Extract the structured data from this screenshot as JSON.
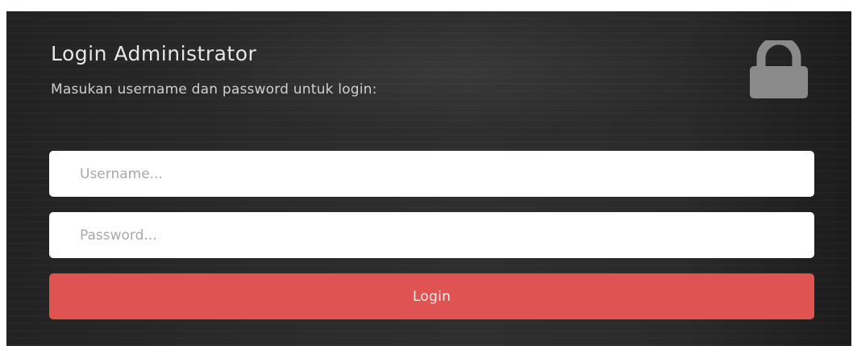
{
  "login_form": {
    "title": "Login Administrator",
    "subtitle": "Masukan username dan password untuk login:",
    "lock_icon": "lock-icon",
    "username": {
      "value": "",
      "placeholder": "Username..."
    },
    "password": {
      "value": "",
      "placeholder": "Password..."
    },
    "login_label": "Login"
  },
  "colors": {
    "panel_background": "#2a2a2a",
    "title_text": "#e6e6e6",
    "lock_icon": "#8a8a8a",
    "input_background": "#ffffff",
    "placeholder_text": "#a9a9a9",
    "login_button": "#e05353"
  }
}
